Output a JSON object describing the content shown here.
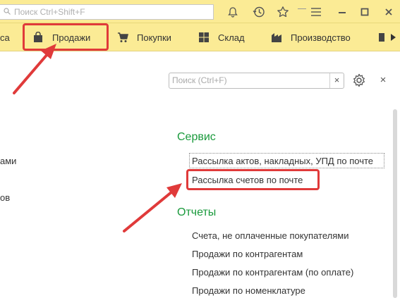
{
  "topbar": {
    "search_placeholder": "Поиск Ctrl+Shift+F",
    "icons": [
      "bell-icon",
      "history-icon",
      "star-icon",
      "menu-icon",
      "minimize-icon",
      "maximize-icon",
      "close-icon"
    ]
  },
  "sections": [
    {
      "label": "са",
      "icon": ""
    },
    {
      "label": "Продажи",
      "icon": "shopping-bag-icon",
      "highlighted": true
    },
    {
      "label": "Покупки",
      "icon": "cart-icon"
    },
    {
      "label": "Склад",
      "icon": "grid-icon"
    },
    {
      "label": "Производство",
      "icon": "factory-icon"
    }
  ],
  "form": {
    "search_placeholder": "Поиск (Ctrl+F)",
    "clear_label": "×",
    "close_label": "×"
  },
  "left_fragments": [
    "ами",
    "ов"
  ],
  "groups": {
    "service": {
      "title": "Сервис",
      "items": [
        "Рассылка актов, накладных, УПД по почте",
        "Рассылка счетов по почте"
      ]
    },
    "reports": {
      "title": "Отчеты",
      "items": [
        "Счета, не оплаченные покупателями",
        "Продажи по контрагентам",
        "Продажи по контрагентам (по оплате)",
        "Продажи по номенклатуре"
      ]
    }
  },
  "colors": {
    "panel": "#fbeb95",
    "accent_red": "#e03a3a",
    "group_green": "#1a9a3c"
  }
}
